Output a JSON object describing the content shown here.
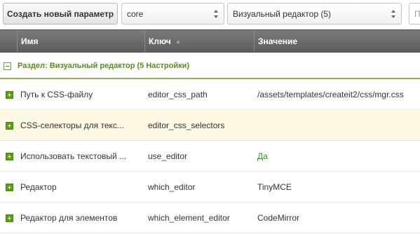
{
  "toolbar": {
    "create_button": "Создать новый параметр",
    "namespace_value": "core",
    "area_value": "Визуальный редактор (5)",
    "search_placeholder": "П"
  },
  "grid": {
    "columns": [
      "Имя",
      "Ключ",
      "Значение"
    ],
    "group_label": "Раздел: Визуальный редактор (5 Настройки)",
    "rows": [
      {
        "name": "Путь к CSS-файлу",
        "key": "editor_css_path",
        "value": "/assets/templates/createit2/css/mgr.css"
      },
      {
        "name": "CSS-селекторы для текс...",
        "key": "editor_css_selectors",
        "value": ""
      },
      {
        "name": "Использовать текстовый ...",
        "key": "use_editor",
        "value": "Да"
      },
      {
        "name": "Редактор",
        "key": "which_editor",
        "value": "TinyMCE"
      },
      {
        "name": "Редактор для элементов",
        "key": "which_element_editor",
        "value": "CodeMirror"
      }
    ]
  },
  "colors": {
    "header_bg": "#6b6b6b",
    "group_text": "#5b8a22",
    "yes_value": "#3a8a2f",
    "alt_row": "#fdf8e4"
  }
}
